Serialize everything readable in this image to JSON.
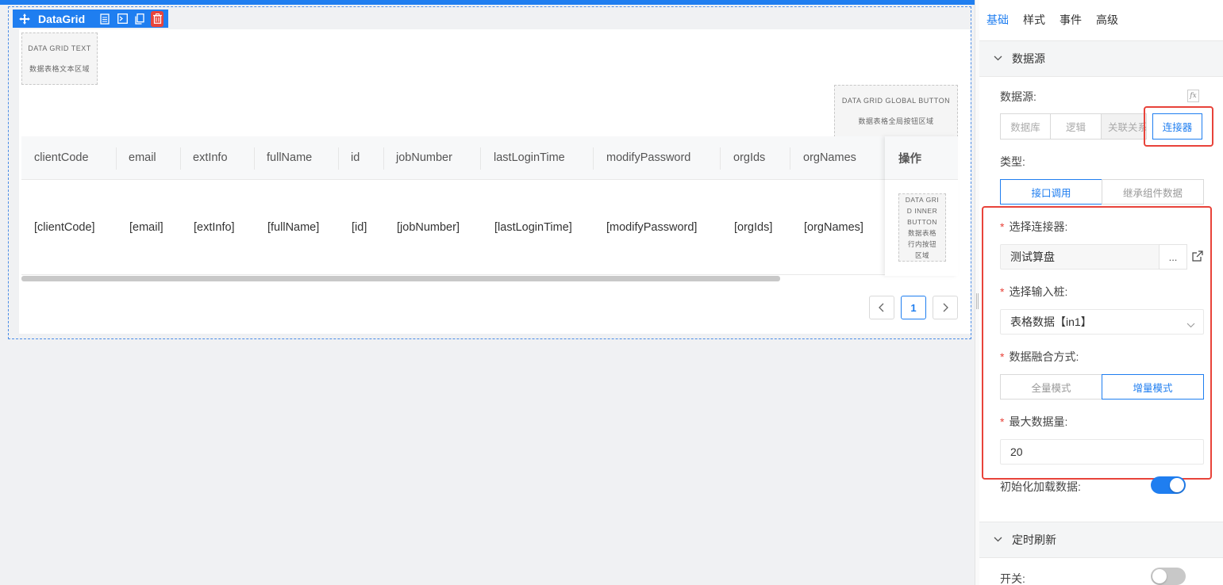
{
  "toolbar": {
    "title": "DataGrid",
    "icons": [
      "move-icon",
      "doc-icon",
      "terminal-icon",
      "copy-icon",
      "trash-icon"
    ]
  },
  "placeholders": {
    "text_area": {
      "en": "DATA GRID TEXT",
      "zh": "数据表格文本区域"
    },
    "global_button": {
      "en": "DATA GRID GLOBAL BUTTON",
      "zh": "数据表格全局按钮区域"
    },
    "inner_button": {
      "en1": "DATA GRI",
      "en2": "D INNER",
      "en3": "BUTTON",
      "zh1": "数据表格",
      "zh2": "行内按钮",
      "zh3": "区域"
    }
  },
  "grid": {
    "columns": [
      "clientCode",
      "email",
      "extInfo",
      "fullName",
      "id",
      "jobNumber",
      "lastLoginTime",
      "modifyPassword",
      "orgIds",
      "orgNames"
    ],
    "row": [
      "[clientCode]",
      "[email]",
      "[extInfo]",
      "[fullName]",
      "[id]",
      "[jobNumber]",
      "[lastLoginTime]",
      "[modifyPassword]",
      "[orgIds]",
      "[orgNames]"
    ],
    "op_header": "操作"
  },
  "pager": {
    "prev": "<",
    "current": "1",
    "next": ">"
  },
  "panel": {
    "tabs": [
      "基础",
      "样式",
      "事件",
      "高级"
    ],
    "section_datasource": "数据源",
    "datasource_label": "数据源:",
    "fx": "fx",
    "source_options": [
      "数据库",
      "逻辑",
      "关联关系",
      "连接器"
    ],
    "type_label": "类型:",
    "type_options": [
      "接口调用",
      "继承组件数据"
    ],
    "connector_label": "选择连接器:",
    "connector_value": "测试算盘",
    "connector_more": "...",
    "input_label": "选择输入桩:",
    "input_value": "表格数据【in1】",
    "merge_label": "数据融合方式:",
    "merge_options": [
      "全量模式",
      "增量模式"
    ],
    "max_label": "最大数据量:",
    "max_value": "20",
    "init_label": "初始化加载数据:",
    "section_refresh": "定时刷新",
    "switch_label": "开关:"
  },
  "colors": {
    "accent": "#1f7ef0",
    "highlight": "#e8433a"
  }
}
